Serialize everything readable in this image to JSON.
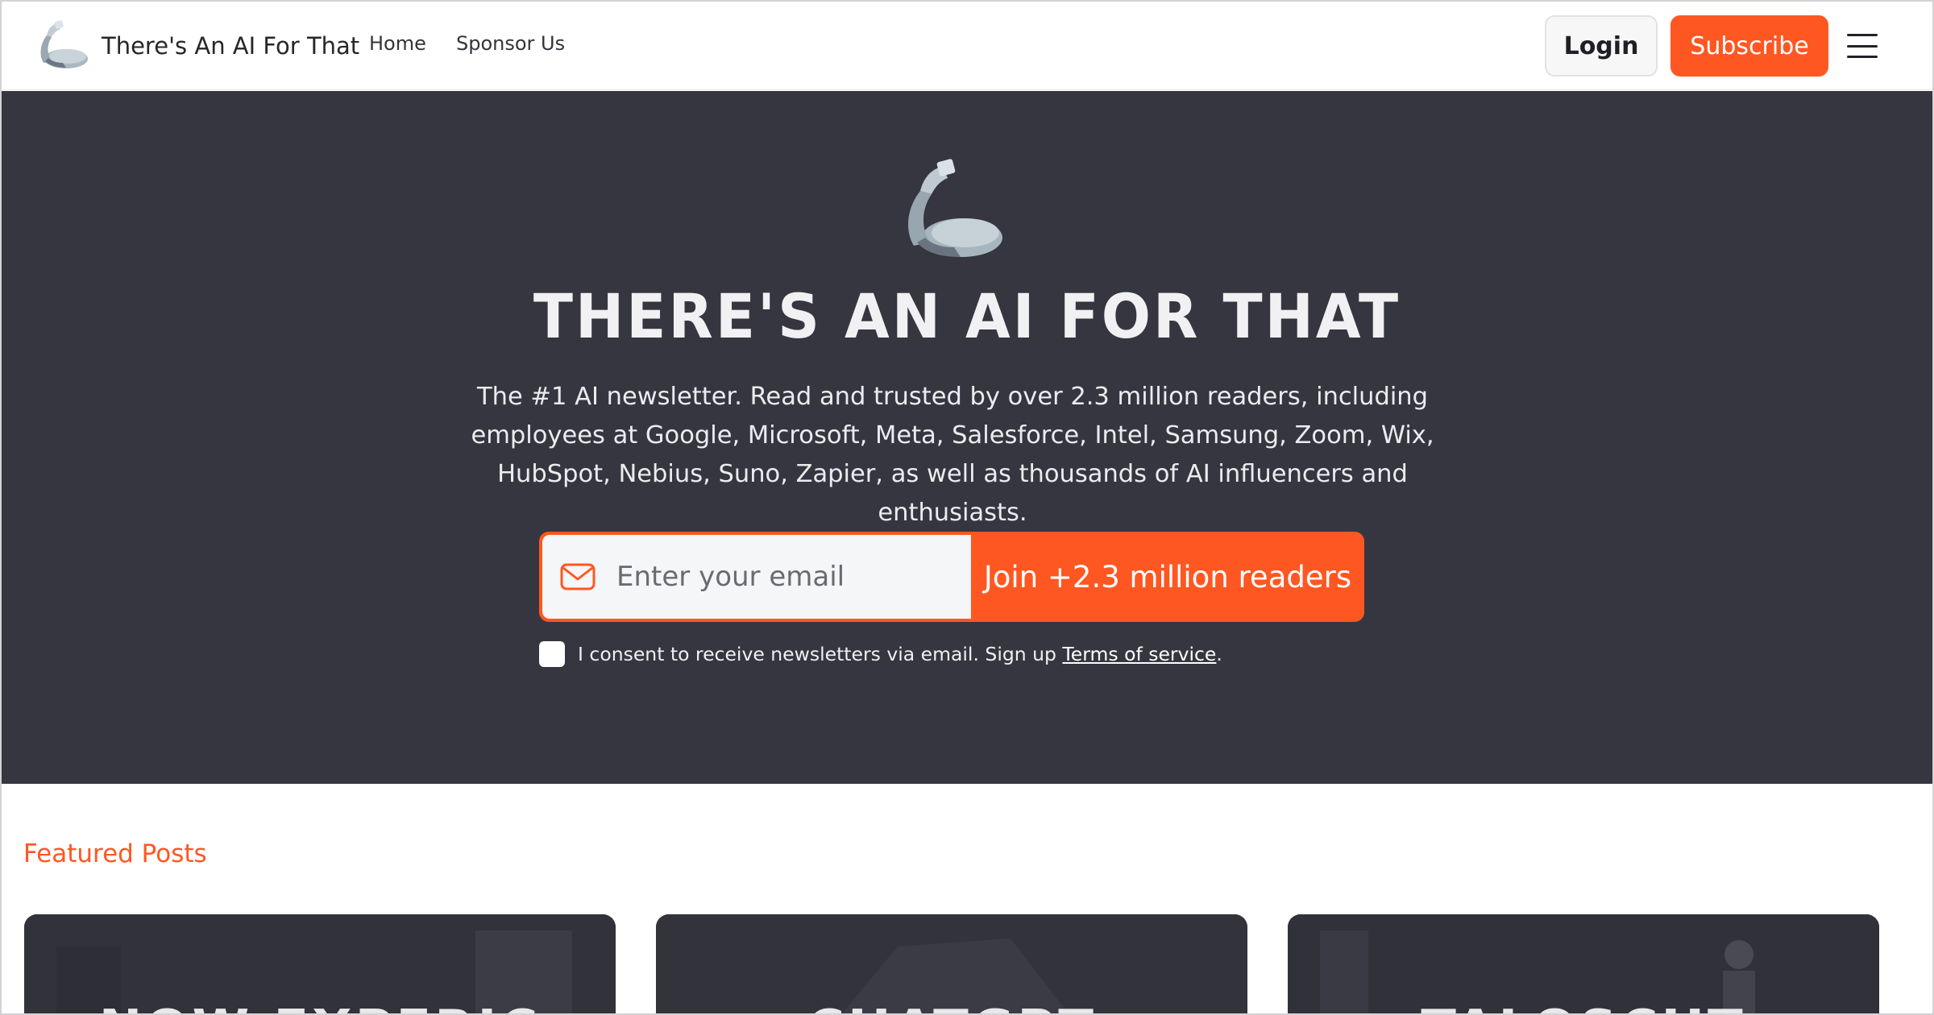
{
  "header": {
    "brand_name": "There's An AI For That",
    "nav": [
      {
        "label": "Home"
      },
      {
        "label": "Sponsor Us"
      }
    ],
    "login_label": "Login",
    "subscribe_label": "Subscribe"
  },
  "hero": {
    "title": "THERE'S AN AI FOR THAT",
    "description": "The #1 AI newsletter. Read and trusted by over 2.3 million readers, including employees at Google, Microsoft, Meta, Salesforce, Intel, Samsung, Zoom, Wix, HubSpot, Nebius, Suno, Zapier, as well as thousands of AI influencers and enthusiasts.",
    "email_placeholder": "Enter your email",
    "join_label": "Join +2.3 million readers",
    "consent_text": "I consent to receive newsletters via email. Sign up ",
    "consent_link": "Terms of service",
    "consent_end": "."
  },
  "featured": {
    "title": "Featured Posts",
    "cards": [
      {
        "label": "NOW EXPERIC"
      },
      {
        "label": "CHATGPT"
      },
      {
        "label": "TALOSCHT"
      }
    ]
  },
  "colors": {
    "accent": "#ff5722",
    "hero_bg": "#363640",
    "card_bg": "#34343d"
  },
  "icons": {
    "brand": "flexed-arm-icon",
    "menu": "hamburger-menu-icon",
    "email": "mail-icon"
  }
}
